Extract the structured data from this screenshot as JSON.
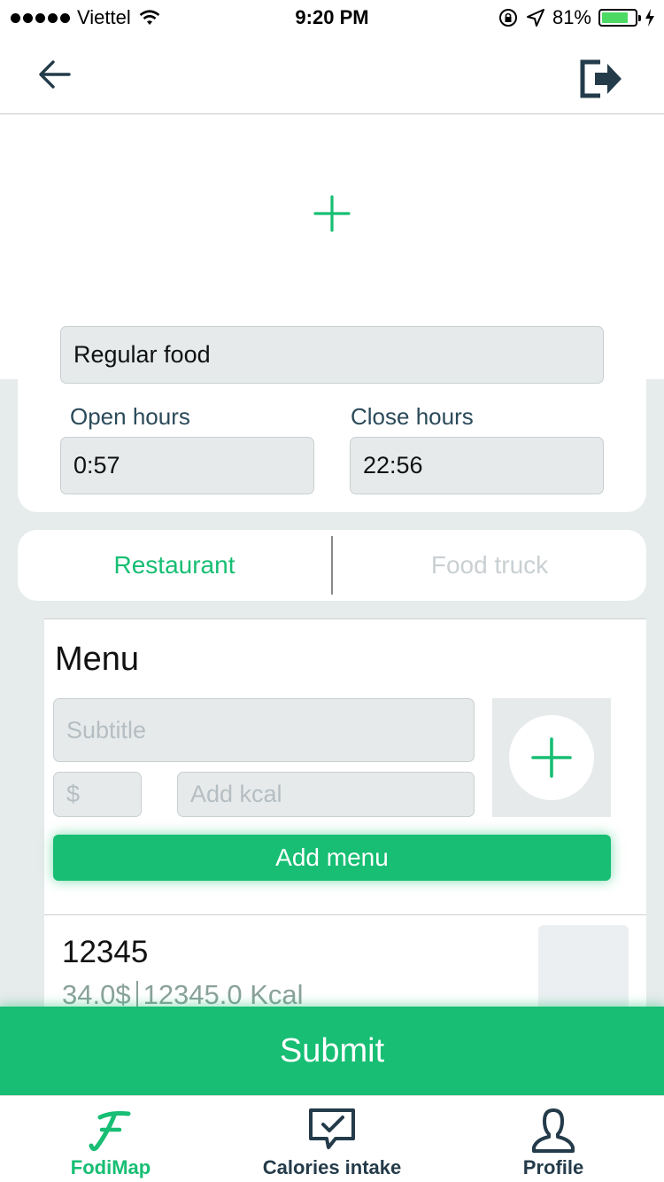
{
  "status_bar": {
    "carrier": "Viettel",
    "time": "9:20 PM",
    "battery_percent": "81%",
    "battery_level": 0.81
  },
  "header": {
    "back_icon": "arrow-left-icon",
    "logout_icon": "logout-icon"
  },
  "form": {
    "category_value": "Regular food",
    "open_hours_label": "Open hours",
    "open_hours_value": "0:57",
    "close_hours_label": "Close hours",
    "close_hours_value": "22:56"
  },
  "type_selector": {
    "options": [
      "Restaurant",
      "Food truck"
    ],
    "selected": "Restaurant"
  },
  "menu": {
    "title": "Menu",
    "subtitle_placeholder": "Subtitle",
    "price_placeholder": "$",
    "kcal_placeholder": "Add kcal",
    "add_button_label": "Add menu",
    "items": [
      {
        "name": "12345",
        "price": "34.0$",
        "kcal": "12345.0 Kcal"
      }
    ]
  },
  "submit_label": "Submit",
  "tab_bar": {
    "tabs": [
      {
        "label": "FodiMap",
        "icon": "fodimap-logo-icon",
        "active": true
      },
      {
        "label": "Calories intake",
        "icon": "chat-check-icon",
        "active": false
      },
      {
        "label": "Profile",
        "icon": "person-icon",
        "active": false
      }
    ]
  },
  "colors": {
    "accent": "#17be73",
    "dark": "#243b4a",
    "background": "#e6ebeb",
    "field": "#e6eaeb",
    "inactive_text": "#c9cfd2"
  }
}
